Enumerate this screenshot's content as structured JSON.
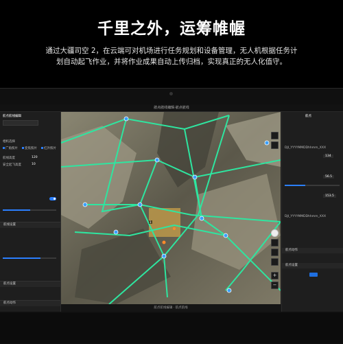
{
  "headline": "千里之外，运筹帷幄",
  "subtitle_line1": "通过大疆司空 2，在云端可对机场进行任务规划和设备管理，无人机根据任务计",
  "subtitle_line2": "划自动起飞作业，并将作业成果自动上传归档，实现真正的无人化值守。",
  "app": {
    "title": "航点航线编辑·航点航线",
    "status_text": "航点航线编辑 · 航点航线",
    "left_panel": {
      "header": "航点航线编辑",
      "section_camera": "相机选择",
      "lens_options": [
        "广角照片",
        "变焦照片",
        "红外照片"
      ],
      "param_label_1": "航线高度",
      "param_label_2": "安全起飞高度",
      "param_value_1": "120",
      "param_value_2": "10",
      "section_route": "航线设置",
      "section_waypoint": "航点设置",
      "section_action": "航点动作"
    },
    "right_panel": {
      "header": "航点",
      "file_1": "DJI_YYYYMMDDhhmm_XXX",
      "file_2": "DJI_YYYYMMDDhhmm_XXX",
      "value_a": "134",
      "value_b": "56.5",
      "value_c": "153.5",
      "section_1": "航点动作",
      "section_2": "航点设置"
    },
    "accent_color": "#2b7fff",
    "route_color": "#2ee6a0",
    "waypoint_color": "#3aa0ff"
  }
}
